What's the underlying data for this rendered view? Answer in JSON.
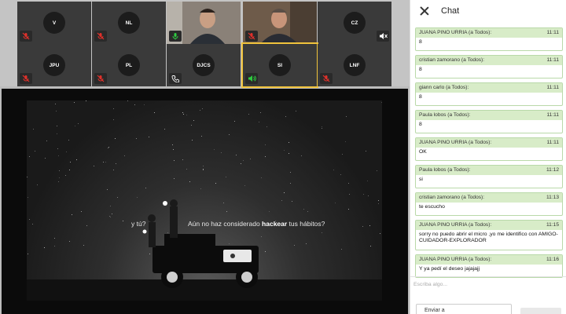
{
  "participants": [
    {
      "initials": "V",
      "status": "muted"
    },
    {
      "initials": "NL",
      "status": "muted"
    },
    {
      "initials": "",
      "status": "mic-on",
      "camera": true
    },
    {
      "initials": "",
      "status": "muted",
      "camera": true
    },
    {
      "initials": "CZ",
      "status": "speaker-muted"
    },
    {
      "initials": "JPU",
      "status": "muted"
    },
    {
      "initials": "PL",
      "status": "muted"
    },
    {
      "initials": "DJCS",
      "status": "phone"
    },
    {
      "initials": "SI",
      "status": "speaking"
    },
    {
      "initials": "LNF",
      "status": "muted"
    }
  ],
  "share": {
    "question": "y tú?",
    "text_before": "Aún no haz considerado ",
    "text_bold": "hackear",
    "text_after": " tus hábitos?"
  },
  "chat": {
    "title": "Chat",
    "messages": [
      {
        "sender": "JUANA PINO URRIA (a Todos):",
        "time": "11:11",
        "text": "8"
      },
      {
        "sender": "cristian zamorano (a Todos):",
        "time": "11:11",
        "text": "8"
      },
      {
        "sender": "giann carlo (a Todos):",
        "time": "11:11",
        "text": "8"
      },
      {
        "sender": "Paula lobos (a Todos):",
        "time": "11:11",
        "text": "8"
      },
      {
        "sender": "JUANA PINO URRIA (a Todos):",
        "time": "11:11",
        "text": "OK"
      },
      {
        "sender": "Paula lobos (a Todos):",
        "time": "11:12",
        "text": "si"
      },
      {
        "sender": "cristian zamorano (a Todos):",
        "time": "11:13",
        "text": "te escucho"
      },
      {
        "sender": "JUANA PINO URRIA (a Todos):",
        "time": "11:15",
        "text": "sorry no puedo abrir el micro ,yo me identifico con AMIGO-CUIDADOR-EXPLORADOR"
      },
      {
        "sender": "JUANA PINO URRIA (a Todos):",
        "time": "11:16",
        "text": "Y ya pedí el deseo jajajajj"
      }
    ],
    "input_placeholder": "Escriba algo...",
    "send_to_label": "Enviar a"
  },
  "colors": {
    "message_header": "#d8ecc8",
    "message_border": "#b9d9a9",
    "active_speaker": "#f0c33c",
    "mic_on": "#2ecc40",
    "muted": "#e0312b"
  }
}
